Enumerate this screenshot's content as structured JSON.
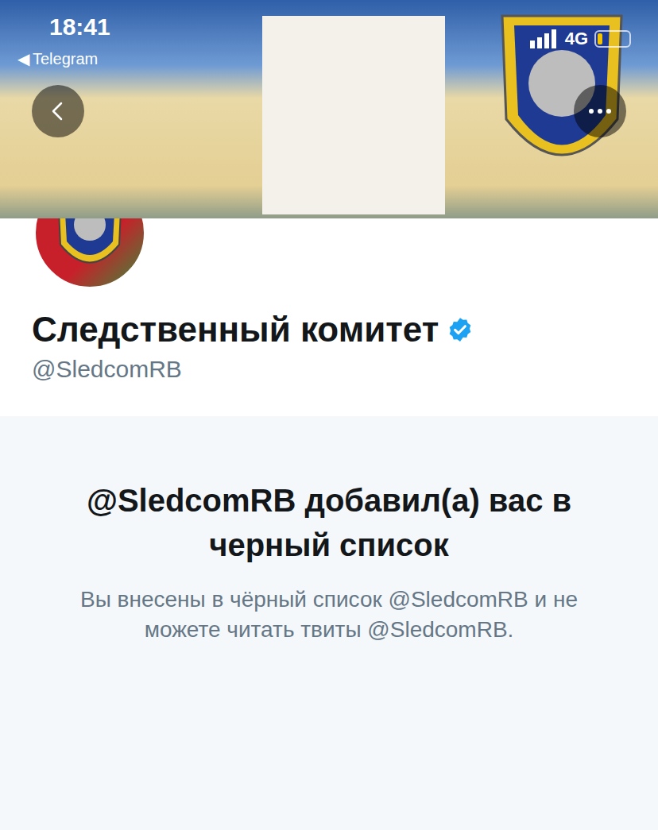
{
  "status_bar": {
    "time": "18:41",
    "back_app_icon": "◀",
    "back_app": "Telegram",
    "network": "4G",
    "battery_level": 0.15
  },
  "profile": {
    "name": "Следственный комитет",
    "verified": true,
    "handle": "@SledcomRB"
  },
  "blocked_notice": {
    "title": "@SledcomRB добавил(а) вас в черный список",
    "message": "Вы внесены в чёрный список @SledcomRB и не можете читать твиты @SledcomRB."
  }
}
